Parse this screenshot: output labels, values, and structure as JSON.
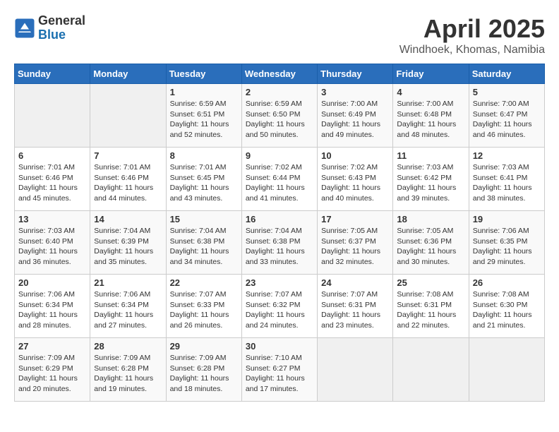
{
  "header": {
    "logo_general": "General",
    "logo_blue": "Blue",
    "month_title": "April 2025",
    "location": "Windhoek, Khomas, Namibia"
  },
  "days_of_week": [
    "Sunday",
    "Monday",
    "Tuesday",
    "Wednesday",
    "Thursday",
    "Friday",
    "Saturday"
  ],
  "weeks": [
    [
      {
        "day": "",
        "empty": true
      },
      {
        "day": "",
        "empty": true
      },
      {
        "day": "1",
        "line1": "Sunrise: 6:59 AM",
        "line2": "Sunset: 6:51 PM",
        "line3": "Daylight: 11 hours",
        "line4": "and 52 minutes."
      },
      {
        "day": "2",
        "line1": "Sunrise: 6:59 AM",
        "line2": "Sunset: 6:50 PM",
        "line3": "Daylight: 11 hours",
        "line4": "and 50 minutes."
      },
      {
        "day": "3",
        "line1": "Sunrise: 7:00 AM",
        "line2": "Sunset: 6:49 PM",
        "line3": "Daylight: 11 hours",
        "line4": "and 49 minutes."
      },
      {
        "day": "4",
        "line1": "Sunrise: 7:00 AM",
        "line2": "Sunset: 6:48 PM",
        "line3": "Daylight: 11 hours",
        "line4": "and 48 minutes."
      },
      {
        "day": "5",
        "line1": "Sunrise: 7:00 AM",
        "line2": "Sunset: 6:47 PM",
        "line3": "Daylight: 11 hours",
        "line4": "and 46 minutes."
      }
    ],
    [
      {
        "day": "6",
        "line1": "Sunrise: 7:01 AM",
        "line2": "Sunset: 6:46 PM",
        "line3": "Daylight: 11 hours",
        "line4": "and 45 minutes."
      },
      {
        "day": "7",
        "line1": "Sunrise: 7:01 AM",
        "line2": "Sunset: 6:46 PM",
        "line3": "Daylight: 11 hours",
        "line4": "and 44 minutes."
      },
      {
        "day": "8",
        "line1": "Sunrise: 7:01 AM",
        "line2": "Sunset: 6:45 PM",
        "line3": "Daylight: 11 hours",
        "line4": "and 43 minutes."
      },
      {
        "day": "9",
        "line1": "Sunrise: 7:02 AM",
        "line2": "Sunset: 6:44 PM",
        "line3": "Daylight: 11 hours",
        "line4": "and 41 minutes."
      },
      {
        "day": "10",
        "line1": "Sunrise: 7:02 AM",
        "line2": "Sunset: 6:43 PM",
        "line3": "Daylight: 11 hours",
        "line4": "and 40 minutes."
      },
      {
        "day": "11",
        "line1": "Sunrise: 7:03 AM",
        "line2": "Sunset: 6:42 PM",
        "line3": "Daylight: 11 hours",
        "line4": "and 39 minutes."
      },
      {
        "day": "12",
        "line1": "Sunrise: 7:03 AM",
        "line2": "Sunset: 6:41 PM",
        "line3": "Daylight: 11 hours",
        "line4": "and 38 minutes."
      }
    ],
    [
      {
        "day": "13",
        "line1": "Sunrise: 7:03 AM",
        "line2": "Sunset: 6:40 PM",
        "line3": "Daylight: 11 hours",
        "line4": "and 36 minutes."
      },
      {
        "day": "14",
        "line1": "Sunrise: 7:04 AM",
        "line2": "Sunset: 6:39 PM",
        "line3": "Daylight: 11 hours",
        "line4": "and 35 minutes."
      },
      {
        "day": "15",
        "line1": "Sunrise: 7:04 AM",
        "line2": "Sunset: 6:38 PM",
        "line3": "Daylight: 11 hours",
        "line4": "and 34 minutes."
      },
      {
        "day": "16",
        "line1": "Sunrise: 7:04 AM",
        "line2": "Sunset: 6:38 PM",
        "line3": "Daylight: 11 hours",
        "line4": "and 33 minutes."
      },
      {
        "day": "17",
        "line1": "Sunrise: 7:05 AM",
        "line2": "Sunset: 6:37 PM",
        "line3": "Daylight: 11 hours",
        "line4": "and 32 minutes."
      },
      {
        "day": "18",
        "line1": "Sunrise: 7:05 AM",
        "line2": "Sunset: 6:36 PM",
        "line3": "Daylight: 11 hours",
        "line4": "and 30 minutes."
      },
      {
        "day": "19",
        "line1": "Sunrise: 7:06 AM",
        "line2": "Sunset: 6:35 PM",
        "line3": "Daylight: 11 hours",
        "line4": "and 29 minutes."
      }
    ],
    [
      {
        "day": "20",
        "line1": "Sunrise: 7:06 AM",
        "line2": "Sunset: 6:34 PM",
        "line3": "Daylight: 11 hours",
        "line4": "and 28 minutes."
      },
      {
        "day": "21",
        "line1": "Sunrise: 7:06 AM",
        "line2": "Sunset: 6:34 PM",
        "line3": "Daylight: 11 hours",
        "line4": "and 27 minutes."
      },
      {
        "day": "22",
        "line1": "Sunrise: 7:07 AM",
        "line2": "Sunset: 6:33 PM",
        "line3": "Daylight: 11 hours",
        "line4": "and 26 minutes."
      },
      {
        "day": "23",
        "line1": "Sunrise: 7:07 AM",
        "line2": "Sunset: 6:32 PM",
        "line3": "Daylight: 11 hours",
        "line4": "and 24 minutes."
      },
      {
        "day": "24",
        "line1": "Sunrise: 7:07 AM",
        "line2": "Sunset: 6:31 PM",
        "line3": "Daylight: 11 hours",
        "line4": "and 23 minutes."
      },
      {
        "day": "25",
        "line1": "Sunrise: 7:08 AM",
        "line2": "Sunset: 6:31 PM",
        "line3": "Daylight: 11 hours",
        "line4": "and 22 minutes."
      },
      {
        "day": "26",
        "line1": "Sunrise: 7:08 AM",
        "line2": "Sunset: 6:30 PM",
        "line3": "Daylight: 11 hours",
        "line4": "and 21 minutes."
      }
    ],
    [
      {
        "day": "27",
        "line1": "Sunrise: 7:09 AM",
        "line2": "Sunset: 6:29 PM",
        "line3": "Daylight: 11 hours",
        "line4": "and 20 minutes."
      },
      {
        "day": "28",
        "line1": "Sunrise: 7:09 AM",
        "line2": "Sunset: 6:28 PM",
        "line3": "Daylight: 11 hours",
        "line4": "and 19 minutes."
      },
      {
        "day": "29",
        "line1": "Sunrise: 7:09 AM",
        "line2": "Sunset: 6:28 PM",
        "line3": "Daylight: 11 hours",
        "line4": "and 18 minutes."
      },
      {
        "day": "30",
        "line1": "Sunrise: 7:10 AM",
        "line2": "Sunset: 6:27 PM",
        "line3": "Daylight: 11 hours",
        "line4": "and 17 minutes."
      },
      {
        "day": "",
        "empty": true
      },
      {
        "day": "",
        "empty": true
      },
      {
        "day": "",
        "empty": true
      }
    ]
  ]
}
